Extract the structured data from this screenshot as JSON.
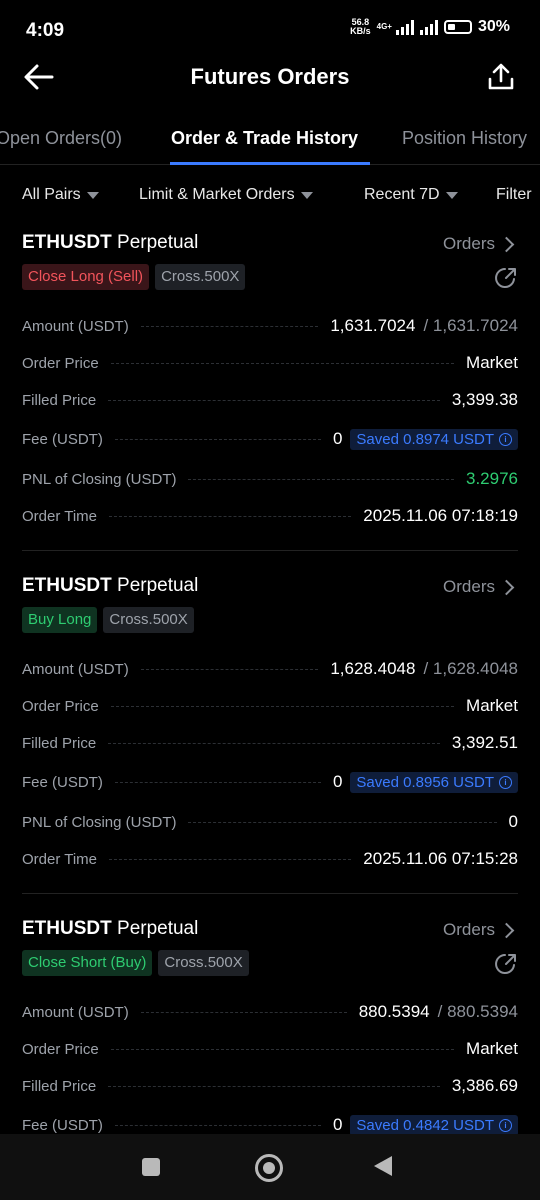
{
  "status_bar": {
    "time": "4:09",
    "net_speed": "56.8",
    "net_unit": "KB/s",
    "net_type": "4G+",
    "battery": "30%"
  },
  "header": {
    "title": "Futures Orders",
    "back_icon": "arrow-left-icon",
    "share_icon": "share-icon"
  },
  "tabs": [
    {
      "label": "Open Orders(0)",
      "active": false
    },
    {
      "label": "Order & Trade History",
      "active": true
    },
    {
      "label": "Position History",
      "active": false
    }
  ],
  "filters": {
    "pairs": "All Pairs",
    "order_type": "Limit & Market Orders",
    "period": "Recent 7D",
    "filter": "Filter"
  },
  "labels": {
    "amount": "Amount (USDT)",
    "order_price": "Order Price",
    "filled_price": "Filled Price",
    "fee": "Fee (USDT)",
    "pnl": "PNL of Closing (USDT)",
    "order_time": "Order Time",
    "orders_link": "Orders",
    "slash": "/"
  },
  "orders": [
    {
      "symbol": "ETHUSDT",
      "kind": "Perpetual",
      "side": "Close Long (Sell)",
      "margin": "Cross.500X",
      "amount": "1,631.7024",
      "amount_total": "1,631.7024",
      "order_price": "Market",
      "filled_price": "3,399.38",
      "fee": "0",
      "saved": "Saved 0.8974 USDT",
      "pnl": "3.2976",
      "order_time": "2025.11.06 07:18:19"
    },
    {
      "symbol": "ETHUSDT",
      "kind": "Perpetual",
      "side": "Buy Long",
      "margin": "Cross.500X",
      "amount": "1,628.4048",
      "amount_total": "1,628.4048",
      "order_price": "Market",
      "filled_price": "3,392.51",
      "fee": "0",
      "saved": "Saved 0.8956 USDT",
      "pnl": "0",
      "order_time": "2025.11.06 07:15:28"
    },
    {
      "symbol": "ETHUSDT",
      "kind": "Perpetual",
      "side": "Close Short (Buy)",
      "margin": "Cross.500X",
      "amount": "880.5394",
      "amount_total": "880.5394",
      "order_price": "Market",
      "filled_price": "3,386.69",
      "fee": "0",
      "saved": "Saved 0.4842 USDT"
    }
  ],
  "colors": {
    "accent": "#3b7bff",
    "sell": "#f2545b",
    "buy": "#2ecc71",
    "background": "#000000"
  }
}
